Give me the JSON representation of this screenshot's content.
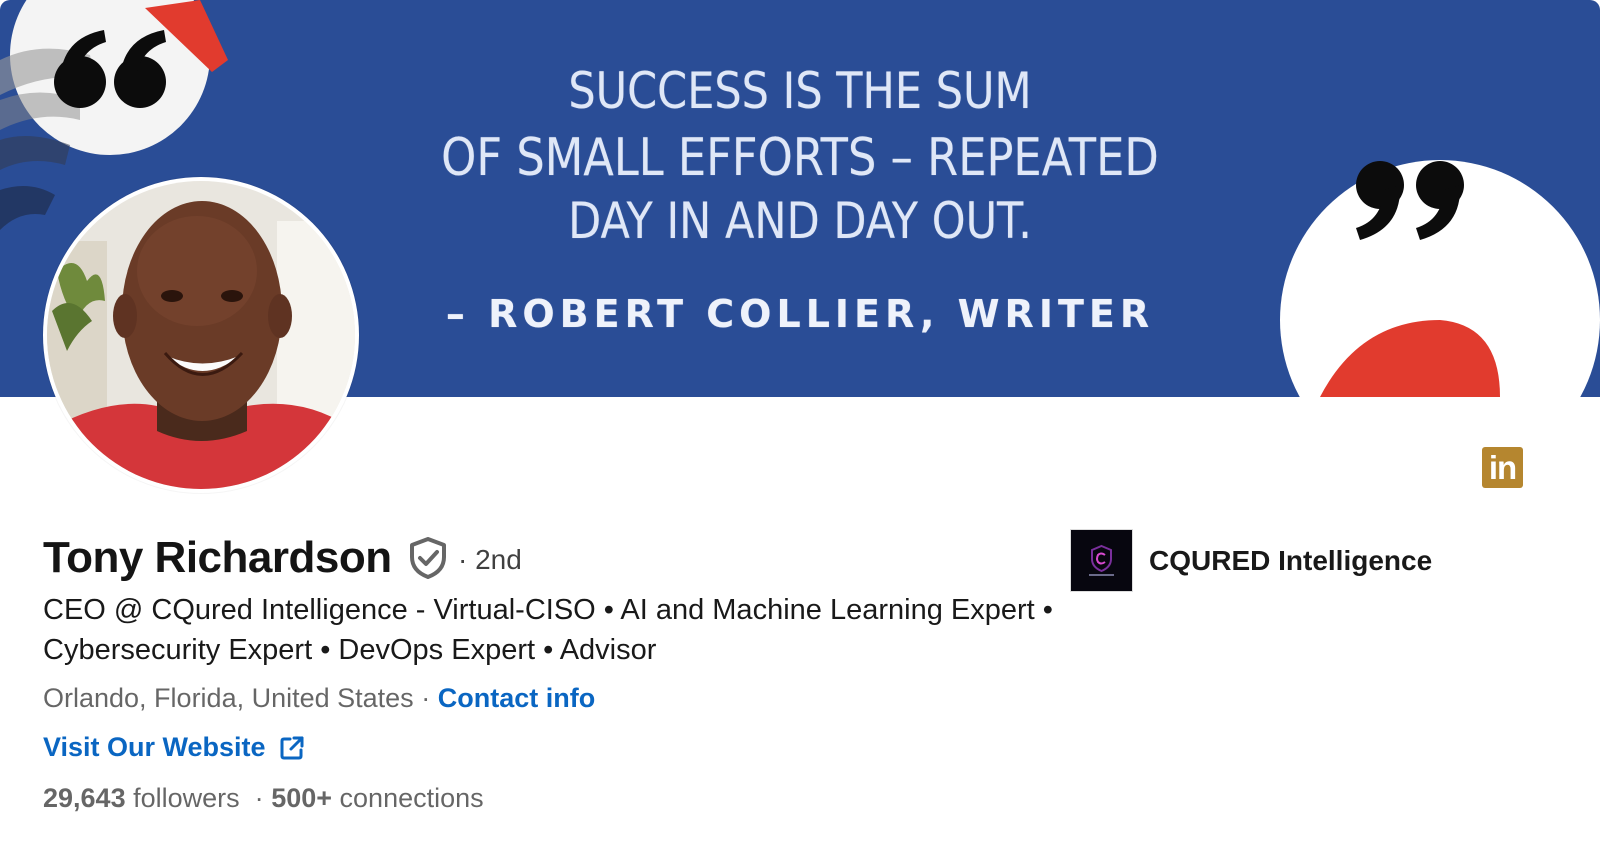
{
  "banner": {
    "quote_line1": "SUCCESS IS THE SUM",
    "quote_line2": "OF SMALL EFFORTS –  REPEATED",
    "quote_line3": "DAY IN AND DAY OUT.",
    "attribution": "– ROBERT COLLIER, WRITER",
    "background_color": "#2a4d96"
  },
  "profile": {
    "name": "Tony Richardson",
    "degree": "· 2nd",
    "headline": "CEO @ CQured Intelligence - Virtual-CISO •  AI and Machine Learning Expert •  Cybersecurity Expert •  DevOps Expert  •  Advisor",
    "location": "Orlando, Florida, United States",
    "separator": "·",
    "contact_info_label": "Contact info",
    "website_label": "Visit Our Website",
    "followers_count": "29,643",
    "followers_label": "followers",
    "connections_count": "500+",
    "connections_label": "connections"
  },
  "company": {
    "name": "CQURED Intelligence"
  },
  "badge": {
    "label": "in",
    "color": "#b5862f"
  },
  "colors": {
    "link": "#0a66c2",
    "banner": "#2a4d96",
    "accent_red": "#e13b2e"
  },
  "icons": {
    "verified": "verified-shield-icon",
    "external_link": "external-link-icon"
  }
}
